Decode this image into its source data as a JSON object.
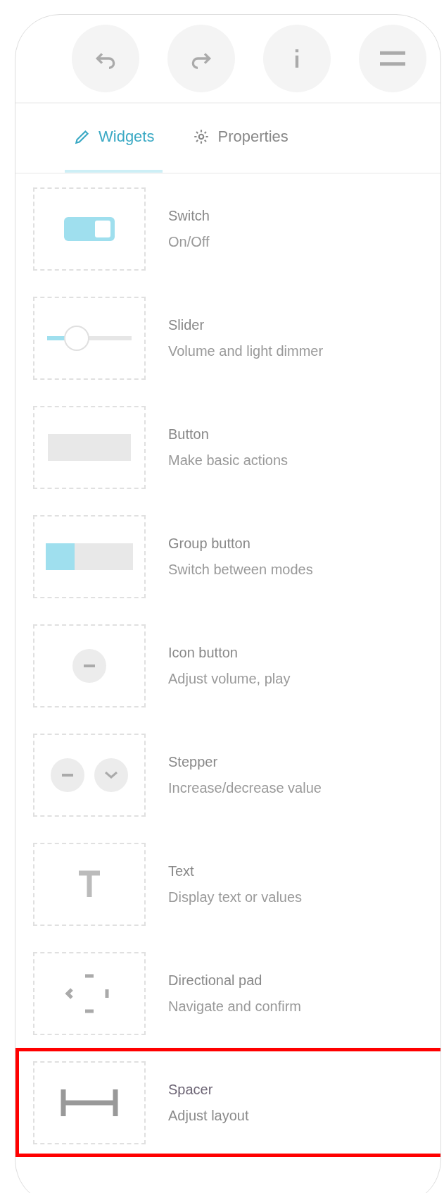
{
  "toolbar": [
    {
      "kind": "undo"
    },
    {
      "kind": "redo"
    },
    {
      "kind": "info"
    },
    {
      "kind": "menu"
    }
  ],
  "tabs": [
    {
      "label": "Widgets",
      "kind": "pencil",
      "selected": true
    },
    {
      "label": "Properties",
      "kind": "gear",
      "selected": false
    }
  ],
  "widgets": [
    {
      "kind": "switch",
      "title": "Switch",
      "subtitle": "On/Off",
      "on": true,
      "selected": false
    },
    {
      "kind": "slider",
      "title": "Slider",
      "subtitle": "Volume and light dimmer",
      "level": 0.35,
      "selected": false
    },
    {
      "kind": "button",
      "title": "Button",
      "subtitle": "Make basic actions",
      "selected": false
    },
    {
      "kind": "group",
      "title": "Group button",
      "subtitle": "Switch between modes",
      "selected": false
    },
    {
      "kind": "iconbutton",
      "title": "Icon button",
      "subtitle": "Adjust volume, play",
      "selected": false
    },
    {
      "kind": "stepper",
      "title": "Stepper",
      "subtitle": "Increase/decrease value",
      "selected": false
    },
    {
      "kind": "text",
      "title": "Text",
      "subtitle": "Display text or values",
      "selected": false
    },
    {
      "kind": "dpad",
      "title": "Directional pad",
      "subtitle": "Navigate and confirm",
      "selected": false
    },
    {
      "kind": "spacer",
      "title": "Spacer",
      "subtitle": "Adjust layout",
      "selected": true
    }
  ]
}
